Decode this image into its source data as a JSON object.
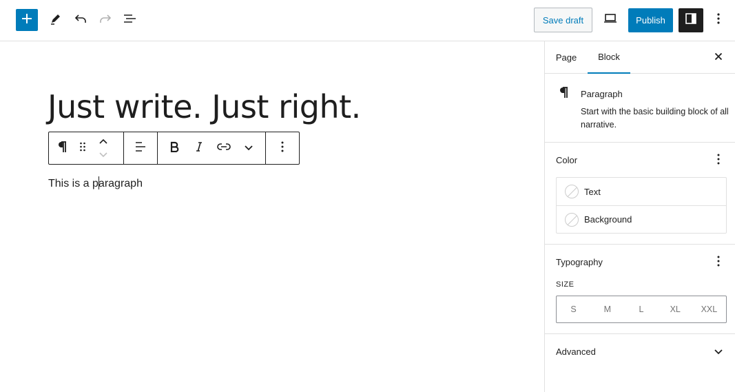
{
  "toolbar": {
    "save_draft": "Save draft",
    "publish": "Publish"
  },
  "editor": {
    "title": "Just write. Just right.",
    "paragraph_before_caret": "This is a p",
    "paragraph_after_caret": "aragraph"
  },
  "sidebar": {
    "tabs": [
      "Page",
      "Block"
    ],
    "active_tab": "Block",
    "block": {
      "name": "Paragraph",
      "description": "Start with the basic building block of all narrative."
    },
    "color": {
      "title": "Color",
      "items": [
        "Text",
        "Background"
      ]
    },
    "typography": {
      "title": "Typography",
      "size_label": "SIZE",
      "sizes": [
        "S",
        "M",
        "L",
        "XL",
        "XXL"
      ]
    },
    "advanced": {
      "title": "Advanced"
    }
  },
  "colors": {
    "accent": "#007cba",
    "dark": "#1e1e1e",
    "border": "#e0e0e0"
  },
  "icons": [
    "plus-icon",
    "pen-icon",
    "undo-icon",
    "redo-icon",
    "list-view-icon",
    "desktop-preview-icon",
    "sidebar-settings-icon",
    "vertical-ellipsis-icon",
    "pilcrow-icon",
    "drag-handle-icon",
    "chevron-up-icon",
    "chevron-down-icon",
    "align-left-icon",
    "bold-icon",
    "italic-icon",
    "link-icon",
    "close-icon",
    "empty-swatch-icon"
  ]
}
